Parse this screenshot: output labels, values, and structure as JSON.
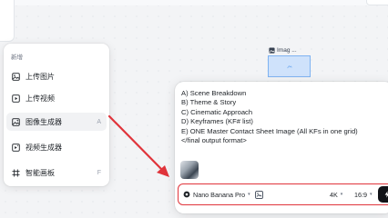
{
  "menu": {
    "title": "新增",
    "items": [
      {
        "label": "上传图片",
        "icon": "image-upload-icon",
        "shortcut": ""
      },
      {
        "label": "上传视频",
        "icon": "video-upload-icon",
        "shortcut": ""
      },
      {
        "label": "图像生成器",
        "icon": "image-generator-icon",
        "shortcut": "A",
        "active": true
      },
      {
        "label": "视频生成器",
        "icon": "video-generator-icon",
        "shortcut": ""
      },
      {
        "label": "智能画板",
        "icon": "smart-canvas-icon",
        "shortcut": "F"
      }
    ]
  },
  "canvas_node": {
    "label": "Imag ..."
  },
  "prompt": {
    "lines": [
      "A) Scene Breakdown",
      "B) Theme & Story",
      "C) Cinematic Approach",
      "D) Keyframes (KF# list)",
      "E) ONE Master Contact Sheet Image (All KFs in one grid)",
      "</final output format>"
    ]
  },
  "toolbar": {
    "model": "Nano Banana Pro",
    "resolution": "4K",
    "aspect_ratio": "16:9"
  },
  "colors": {
    "highlight_red": "#e0343b",
    "node_blue": "#cfe2fb",
    "generate_button": "#111318"
  }
}
